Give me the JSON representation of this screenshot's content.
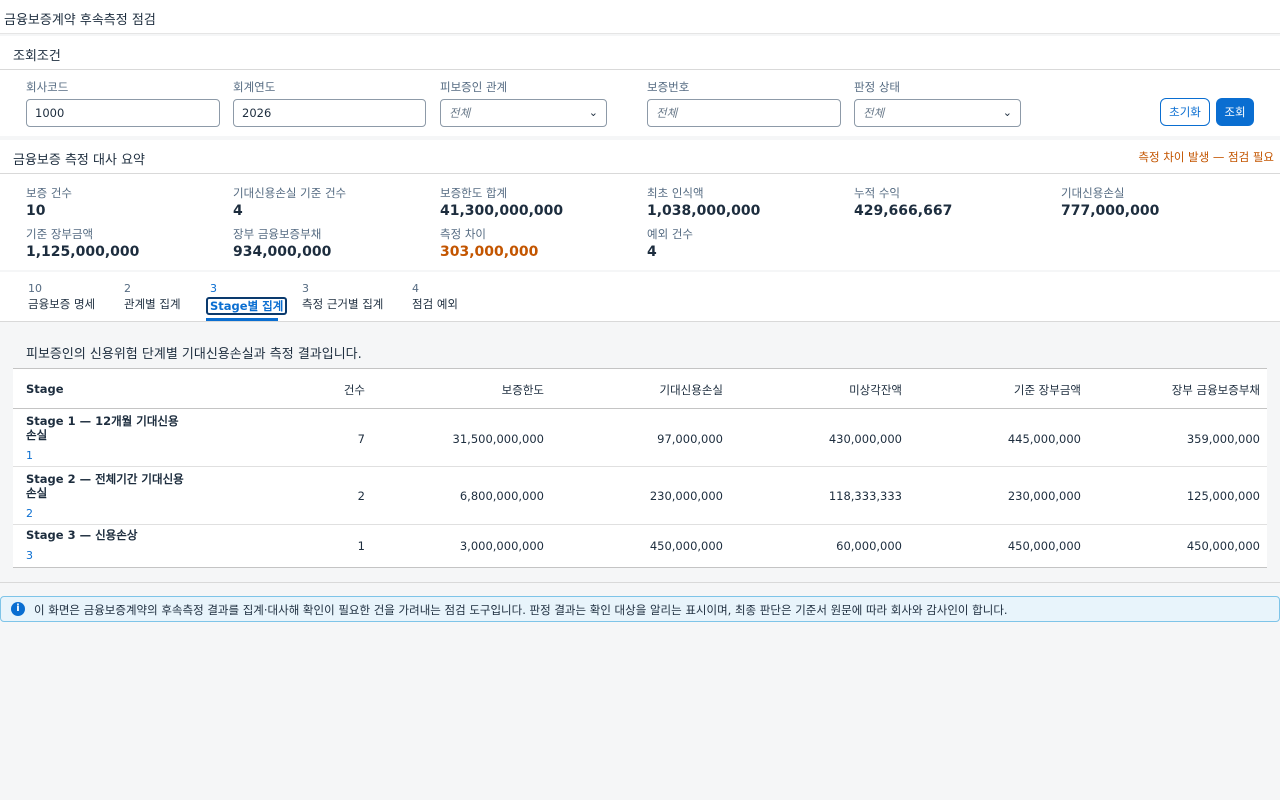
{
  "app": {
    "title": "금융보증계약 후속측정 점검"
  },
  "filter": {
    "title": "조회조건",
    "company_code": {
      "label": "회사코드",
      "value": "1000"
    },
    "fiscal_year": {
      "label": "회계연도",
      "value": "2026"
    },
    "relation": {
      "label": "피보증인 관계",
      "value": "전체"
    },
    "guarantee_no": {
      "label": "보증번호",
      "placeholder": "전체"
    },
    "judgement": {
      "label": "판정 상태",
      "value": "전체"
    },
    "reset_label": "초기화",
    "search_label": "조회"
  },
  "summary": {
    "title": "금융보증 측정 대사 요약",
    "warning": "측정 차이 발생 — 점검 필요",
    "kpis": [
      {
        "label": "보증 건수",
        "value": "10"
      },
      {
        "label": "기대신용손실 기준 건수",
        "value": "4"
      },
      {
        "label": "보증한도 합계",
        "value": "41,300,000,000"
      },
      {
        "label": "최초 인식액",
        "value": "1,038,000,000"
      },
      {
        "label": "누적 수익",
        "value": "429,666,667"
      },
      {
        "label": "기대신용손실",
        "value": "777,000,000"
      },
      {
        "label": "기준 장부금액",
        "value": "1,125,000,000"
      },
      {
        "label": "장부 금융보증부채",
        "value": "934,000,000"
      },
      {
        "label": "측정 차이",
        "value": "303,000,000"
      },
      {
        "label": "예외 건수",
        "value": "4"
      }
    ]
  },
  "tabs": [
    {
      "count": "10",
      "label": "금융보증 명세"
    },
    {
      "count": "2",
      "label": "관계별 집계"
    },
    {
      "count": "3",
      "label": "Stage별 집계"
    },
    {
      "count": "3",
      "label": "측정 근거별 집계"
    },
    {
      "count": "4",
      "label": "점검 예외"
    }
  ],
  "content": {
    "description": "피보증인의 신용위험 단계별 기대신용손실과 측정 결과입니다.",
    "columns": [
      "Stage",
      "건수",
      "보증한도",
      "기대신용손실",
      "미상각잔액",
      "기준 장부금액",
      "장부 금융보증부채"
    ],
    "rows": [
      {
        "name": "Stage 1 — 12개월 기대신용손실",
        "code": "1",
        "count": "7",
        "limit": "31,500,000,000",
        "ecl": "97,000,000",
        "unamortized": "430,000,000",
        "base_amount": "445,000,000",
        "book_liability": "359,000,000"
      },
      {
        "name": "Stage 2 — 전체기간 기대신용손실",
        "code": "2",
        "count": "2",
        "limit": "6,800,000,000",
        "ecl": "230,000,000",
        "unamortized": "118,333,333",
        "base_amount": "230,000,000",
        "book_liability": "125,000,000"
      },
      {
        "name": "Stage 3 — 신용손상",
        "code": "3",
        "count": "1",
        "limit": "3,000,000,000",
        "ecl": "450,000,000",
        "unamortized": "60,000,000",
        "base_amount": "450,000,000",
        "book_liability": "450,000,000"
      }
    ]
  },
  "info": {
    "icon": "info-icon",
    "text": "이 화면은 금융보증계약의 후속측정 결과를 집계·대사해 확인이 필요한 건을 가려내는 점검 도구입니다. 판정 결과는 확인 대상을 알리는 표시이며, 최종 판단은 기준서 원문에 따라 회사와 감사인이 합니다."
  },
  "colors": {
    "accent": "#0a6ed1",
    "warning": "#c35500"
  }
}
